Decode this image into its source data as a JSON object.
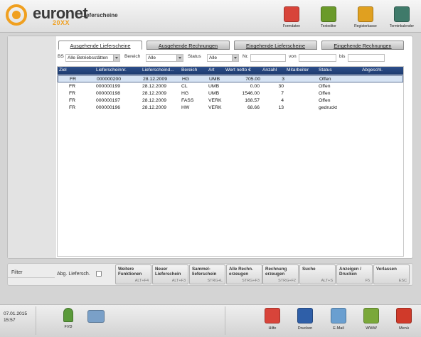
{
  "brand": {
    "name": "euronet",
    "sub": "20XX",
    "module": "Lieferscheine"
  },
  "header_buttons": [
    {
      "label": "Formdaten",
      "icon": "form-data-icon",
      "color": "#d8443a"
    },
    {
      "label": "Texteditor",
      "icon": "pencil-icon",
      "color": "#6a9a2a"
    },
    {
      "label": "Registerkasse",
      "icon": "cash-register-icon",
      "color": "#e0a020"
    },
    {
      "label": "Terminkalender",
      "icon": "calendar-icon",
      "color": "#3f7a6a"
    }
  ],
  "tabs": [
    {
      "label": "Ausgehende Lieferscheine",
      "active": true
    },
    {
      "label": "Ausgehende Rechnungen",
      "active": false
    },
    {
      "label": "Eingehende Lieferscheine",
      "active": false
    },
    {
      "label": "Eingehende Rechnungen",
      "active": false
    }
  ],
  "filters": {
    "bs_label": "BS",
    "bs_value": "Alle Betriebsstätten",
    "bereich_label": "Bereich",
    "bereich_value": "Alle",
    "status_label": "Status",
    "status_value": "Alle",
    "nr_label": "Nr.",
    "von_label": "von",
    "bis_label": "bis"
  },
  "table": {
    "columns": [
      "Ziel",
      "Lieferscheinnr.",
      "Lieferscheind...",
      "Bereich",
      "Art",
      "Wert netto €",
      "Anzahl",
      "Mitarbeiter",
      "Status",
      "Abgeschl."
    ],
    "rows": [
      {
        "ziel": "FR",
        "nr": "000000200",
        "datum": "28.12.2009",
        "bereich": "HG",
        "art": "UMB",
        "wert": "705.00",
        "anzahl": "3",
        "mitarbeiter": "",
        "status": "Offen",
        "selected": true
      },
      {
        "ziel": "FR",
        "nr": "000000199",
        "datum": "28.12.2009",
        "bereich": "CL",
        "art": "UMB",
        "wert": "0.00",
        "anzahl": "30",
        "mitarbeiter": "",
        "status": "Offen",
        "selected": false
      },
      {
        "ziel": "FR",
        "nr": "000000198",
        "datum": "28.12.2009",
        "bereich": "HG",
        "art": "UMB",
        "wert": "1546.00",
        "anzahl": "7",
        "mitarbeiter": "",
        "status": "Offen",
        "selected": false
      },
      {
        "ziel": "FR",
        "nr": "000000197",
        "datum": "28.12.2009",
        "bereich": "FASS",
        "art": "VERK",
        "wert": "168.57",
        "anzahl": "4",
        "mitarbeiter": "",
        "status": "Offen",
        "selected": false
      },
      {
        "ziel": "FR",
        "nr": "000000196",
        "datum": "28.12.2009",
        "bereich": "HW",
        "art": "VERK",
        "wert": "68.66",
        "anzahl": "13",
        "mitarbeiter": "",
        "status": "gedruckt",
        "selected": false
      }
    ]
  },
  "bottom": {
    "filter_label": "Filter",
    "abg_label": "Abg. Liefersch."
  },
  "function_buttons": [
    {
      "label": "Weitere\nFunktionen",
      "key": "ALT+F4"
    },
    {
      "label": "Neuer\nLieferschein",
      "key": "ALT+F3"
    },
    {
      "label": "Sammel-\nlieferschein",
      "key": "STRG+L"
    },
    {
      "label": "Alle Rechn.\nerzeugen",
      "key": "STRG+F3"
    },
    {
      "label": "Rechnung\nerzeugen",
      "key": "STRG+F2"
    },
    {
      "label": "Suche",
      "key": "ALT+S"
    },
    {
      "label": "Anzeigen /\nDrucken",
      "key": "F5"
    },
    {
      "label": "Verlassen",
      "key": "ESC"
    }
  ],
  "taskbar": {
    "date": "07.01.2015",
    "time": "15:57",
    "fvd_label": "FVD",
    "buttons": [
      {
        "label": "Hilfe",
        "icon": "help-icon",
        "color": "#d8443a"
      },
      {
        "label": "Drucken",
        "icon": "printer-icon",
        "color": "#2f5fa8"
      },
      {
        "label": "E-Mail",
        "icon": "email-icon",
        "color": "#6a9fd0"
      },
      {
        "label": "WWW",
        "icon": "globe-icon",
        "color": "#7aa83a"
      },
      {
        "label": "Menü",
        "icon": "menu-grid-icon",
        "color": "#d03a2a"
      }
    ]
  }
}
